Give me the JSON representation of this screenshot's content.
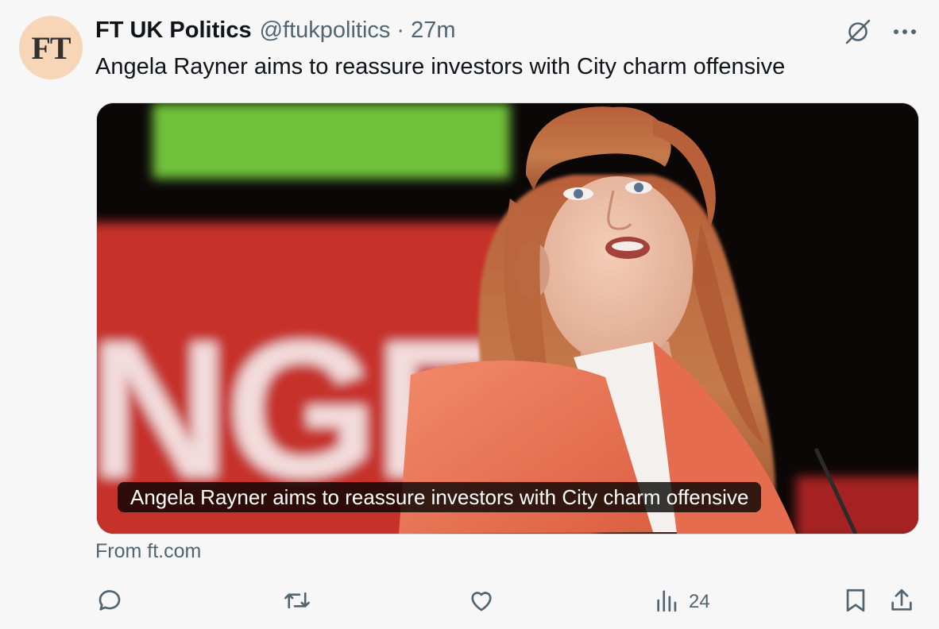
{
  "tweet": {
    "avatar_text": "FT",
    "display_name": "FT UK Politics",
    "handle": "@ftukpolitics",
    "separator": "·",
    "time": "27m",
    "text": "Angela Rayner aims to reassure investors with City charm offensive",
    "card": {
      "caption": "Angela Rayner aims to reassure investors with City charm offensive",
      "banner_letters": "NGE"
    },
    "source": "From ft.com",
    "stats": {
      "views": "24"
    }
  },
  "icons": {
    "grok": "grok-icon",
    "more": "more-icon",
    "reply": "reply-icon",
    "repost": "repost-icon",
    "like": "like-icon",
    "views": "views-icon",
    "bookmark": "bookmark-icon",
    "share": "share-icon"
  },
  "colors": {
    "background": "#f7f7f7",
    "primary_text": "#0f1419",
    "secondary_text": "#536471",
    "avatar_bg": "#f7d6b8",
    "banner_red": "#c6302c",
    "banner_green": "#6fc23a",
    "jacket_coral": "#ee7757"
  }
}
